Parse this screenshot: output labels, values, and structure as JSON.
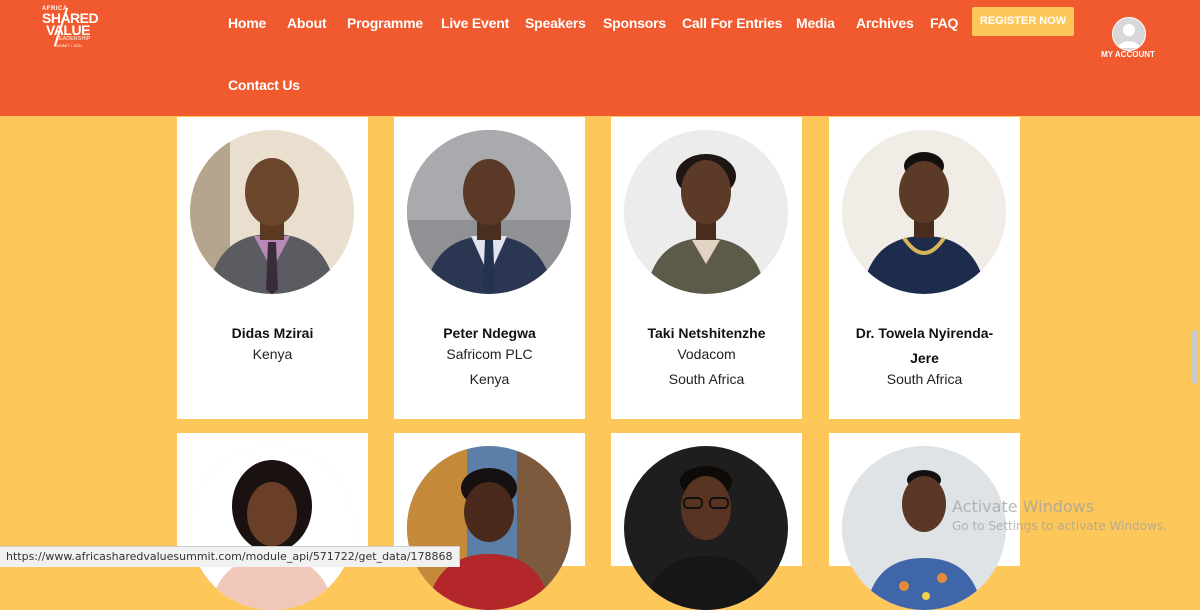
{
  "brand": {
    "logo_line1": "AFRICA",
    "logo_line2": "SHARED",
    "logo_line3": "VALUE",
    "logo_line4": "LEADERSHIP",
    "logo_line5": "SUMMIT • 2021"
  },
  "nav": {
    "items": [
      {
        "label": "Home"
      },
      {
        "label": "About"
      },
      {
        "label": "Programme"
      },
      {
        "label": "Live Event"
      },
      {
        "label": "Speakers"
      },
      {
        "label": "Sponsors"
      },
      {
        "label": "Call For Entries"
      },
      {
        "label": "Media"
      },
      {
        "label": "Archives"
      },
      {
        "label": "FAQ"
      }
    ],
    "contact": "Contact Us",
    "register": "REGISTER NOW",
    "account": "MY ACCOUNT"
  },
  "speakers": [
    {
      "name": "Didas Mzirai",
      "lines": [
        "Kenya"
      ]
    },
    {
      "name": "Peter Ndegwa",
      "lines": [
        "Safricom PLC",
        "Kenya"
      ]
    },
    {
      "name": "Taki Netshitenzhe",
      "lines": [
        "Vodacom",
        "South Africa"
      ]
    },
    {
      "name_lines": [
        "Dr. Towela Nyirenda-",
        "Jere"
      ],
      "lines": [
        "South Africa"
      ]
    }
  ],
  "status_url": "https://www.africasharedvaluesummit.com/module_api/571722/get_data/178868",
  "watermark": {
    "title": "Activate Windows",
    "subtitle": "Go to Settings to activate Windows."
  },
  "colors": {
    "header": "#f05a2e",
    "page": "#fdc75a",
    "card": "#ffffff"
  }
}
